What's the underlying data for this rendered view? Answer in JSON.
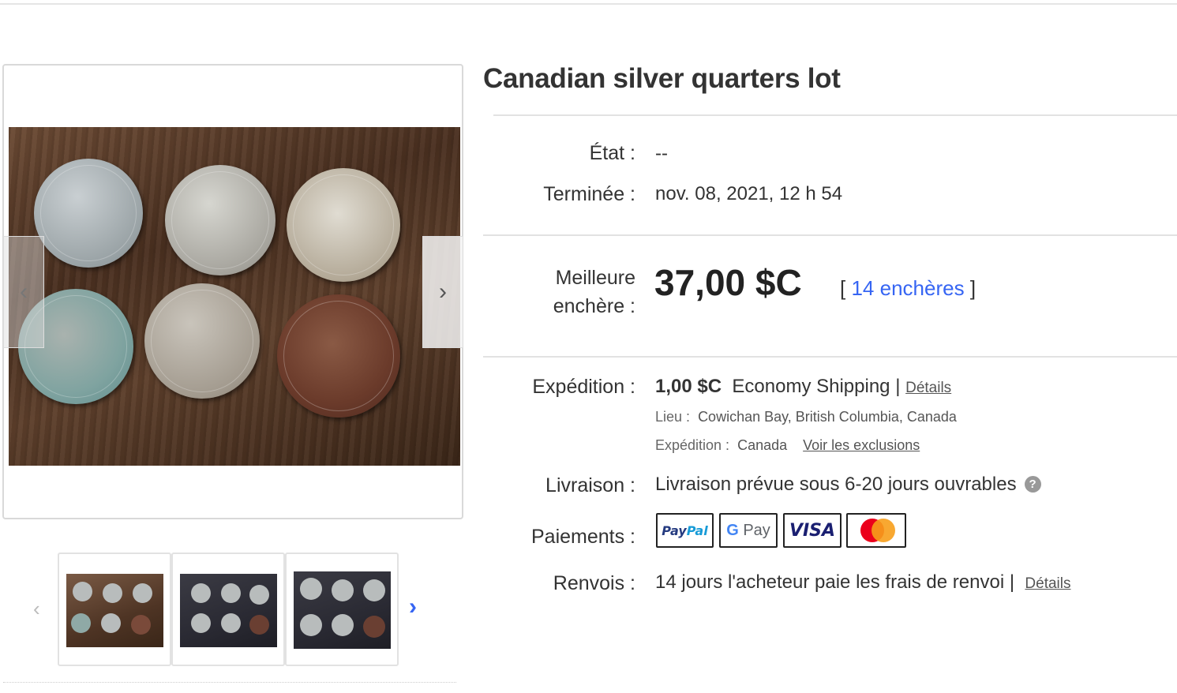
{
  "listing": {
    "title": "Canadian silver quarters lot"
  },
  "details": {
    "condition_label": "État :",
    "condition_value": "--",
    "ended_label": "Terminée :",
    "ended_value": "nov. 08, 2021, 12 h 54",
    "best_bid_label_line1": "Meilleure",
    "best_bid_label_line2": "enchère :",
    "best_bid_value": "37,00 $C",
    "bids_open": "[",
    "bids_link": "14 enchères",
    "bids_close": "]"
  },
  "shipping": {
    "label": "Expédition :",
    "price": "1,00 $C",
    "method": "Economy Shipping",
    "separator": "|",
    "details_link": "Détails",
    "location_label": "Lieu :",
    "location_value": "Cowichan Bay, British Columbia, Canada",
    "ships_to_label": "Expédition :",
    "ships_to_value": "Canada",
    "exclusions_link": "Voir les exclusions"
  },
  "delivery": {
    "label": "Livraison :",
    "value": "Livraison prévue sous 6-20 jours ouvrables",
    "help_glyph": "?"
  },
  "payments": {
    "label": "Paiements :",
    "paypal": {
      "part1": "Pay",
      "part2": "Pal"
    },
    "gpay": {
      "g": "G",
      "rest": " Pay"
    },
    "visa": "VISA",
    "mastercard": "mastercard-logo"
  },
  "returns": {
    "label": "Renvois :",
    "value": "14 jours l'acheteur paie les frais de renvoi |",
    "details_link": "Détails"
  },
  "gallery": {
    "prev_glyph": "‹",
    "next_glyph": "›",
    "thumb_prev_glyph": "‹",
    "thumb_next_glyph": "›"
  },
  "colors": {
    "link_blue": "#3665f3",
    "text": "#333333",
    "border": "#d9d9d9"
  }
}
